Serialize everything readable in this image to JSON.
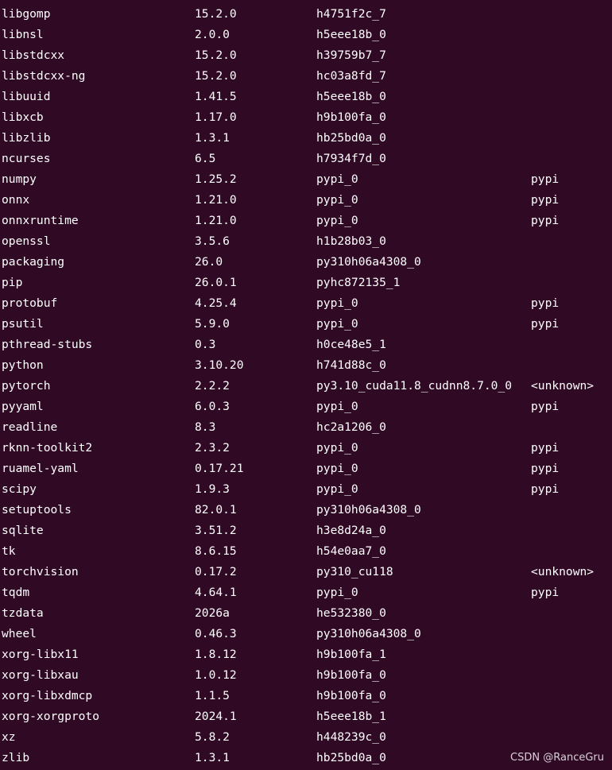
{
  "packages": [
    {
      "name": "libgomp",
      "version": "15.2.0",
      "build": "h4751f2c_7",
      "channel": ""
    },
    {
      "name": "libnsl",
      "version": "2.0.0",
      "build": "h5eee18b_0",
      "channel": ""
    },
    {
      "name": "libstdcxx",
      "version": "15.2.0",
      "build": "h39759b7_7",
      "channel": ""
    },
    {
      "name": "libstdcxx-ng",
      "version": "15.2.0",
      "build": "hc03a8fd_7",
      "channel": ""
    },
    {
      "name": "libuuid",
      "version": "1.41.5",
      "build": "h5eee18b_0",
      "channel": ""
    },
    {
      "name": "libxcb",
      "version": "1.17.0",
      "build": "h9b100fa_0",
      "channel": ""
    },
    {
      "name": "libzlib",
      "version": "1.3.1",
      "build": "hb25bd0a_0",
      "channel": ""
    },
    {
      "name": "ncurses",
      "version": "6.5",
      "build": "h7934f7d_0",
      "channel": ""
    },
    {
      "name": "numpy",
      "version": "1.25.2",
      "build": "pypi_0",
      "channel": "pypi"
    },
    {
      "name": "onnx",
      "version": "1.21.0",
      "build": "pypi_0",
      "channel": "pypi"
    },
    {
      "name": "onnxruntime",
      "version": "1.21.0",
      "build": "pypi_0",
      "channel": "pypi"
    },
    {
      "name": "openssl",
      "version": "3.5.6",
      "build": "h1b28b03_0",
      "channel": ""
    },
    {
      "name": "packaging",
      "version": "26.0",
      "build": "py310h06a4308_0",
      "channel": ""
    },
    {
      "name": "pip",
      "version": "26.0.1",
      "build": "pyhc872135_1",
      "channel": ""
    },
    {
      "name": "protobuf",
      "version": "4.25.4",
      "build": "pypi_0",
      "channel": "pypi"
    },
    {
      "name": "psutil",
      "version": "5.9.0",
      "build": "pypi_0",
      "channel": "pypi"
    },
    {
      "name": "pthread-stubs",
      "version": "0.3",
      "build": "h0ce48e5_1",
      "channel": ""
    },
    {
      "name": "python",
      "version": "3.10.20",
      "build": "h741d88c_0",
      "channel": ""
    },
    {
      "name": "pytorch",
      "version": "2.2.2",
      "build": "py3.10_cuda11.8_cudnn8.7.0_0",
      "channel": "<unknown>"
    },
    {
      "name": "pyyaml",
      "version": "6.0.3",
      "build": "pypi_0",
      "channel": "pypi"
    },
    {
      "name": "readline",
      "version": "8.3",
      "build": "hc2a1206_0",
      "channel": ""
    },
    {
      "name": "rknn-toolkit2",
      "version": "2.3.2",
      "build": "pypi_0",
      "channel": "pypi"
    },
    {
      "name": "ruamel-yaml",
      "version": "0.17.21",
      "build": "pypi_0",
      "channel": "pypi"
    },
    {
      "name": "scipy",
      "version": "1.9.3",
      "build": "pypi_0",
      "channel": "pypi"
    },
    {
      "name": "setuptools",
      "version": "82.0.1",
      "build": "py310h06a4308_0",
      "channel": ""
    },
    {
      "name": "sqlite",
      "version": "3.51.2",
      "build": "h3e8d24a_0",
      "channel": ""
    },
    {
      "name": "tk",
      "version": "8.6.15",
      "build": "h54e0aa7_0",
      "channel": ""
    },
    {
      "name": "torchvision",
      "version": "0.17.2",
      "build": "py310_cu118",
      "channel": "<unknown>"
    },
    {
      "name": "tqdm",
      "version": "4.64.1",
      "build": "pypi_0",
      "channel": "pypi"
    },
    {
      "name": "tzdata",
      "version": "2026a",
      "build": "he532380_0",
      "channel": ""
    },
    {
      "name": "wheel",
      "version": "0.46.3",
      "build": "py310h06a4308_0",
      "channel": ""
    },
    {
      "name": "xorg-libx11",
      "version": "1.8.12",
      "build": "h9b100fa_1",
      "channel": ""
    },
    {
      "name": "xorg-libxau",
      "version": "1.0.12",
      "build": "h9b100fa_0",
      "channel": ""
    },
    {
      "name": "xorg-libxdmcp",
      "version": "1.1.5",
      "build": "h9b100fa_0",
      "channel": ""
    },
    {
      "name": "xorg-xorgproto",
      "version": "2024.1",
      "build": "h5eee18b_1",
      "channel": ""
    },
    {
      "name": "xz",
      "version": "5.8.2",
      "build": "h448239c_0",
      "channel": ""
    },
    {
      "name": "zlib",
      "version": "1.3.1",
      "build": "hb25bd0a_0",
      "channel": ""
    }
  ],
  "watermark": "CSDN @RanceGru",
  "colors": {
    "background": "#300a24",
    "text": "#ffffff"
  }
}
